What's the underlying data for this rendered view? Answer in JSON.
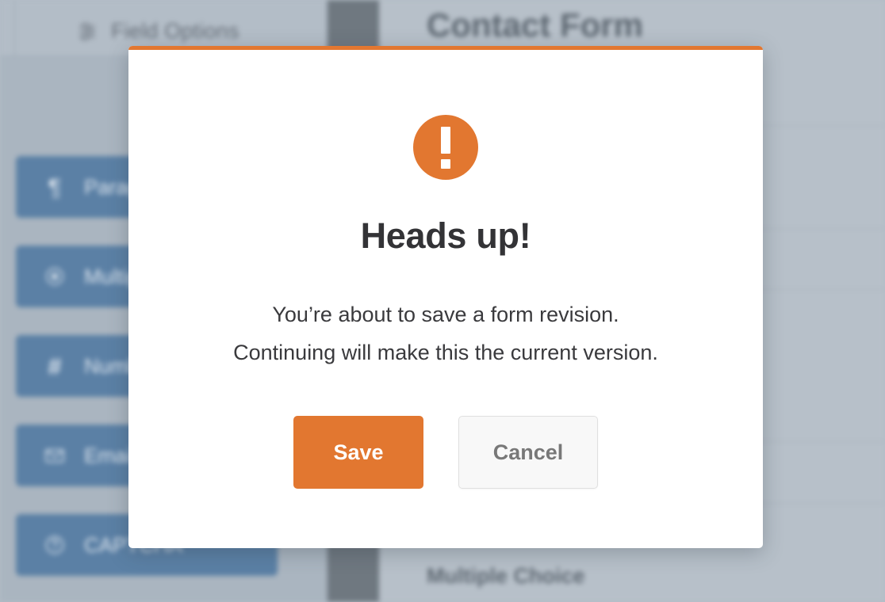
{
  "background": {
    "panel": {
      "header_label": "Field Options",
      "header_icon": "sliders-icon",
      "fields": [
        {
          "label": "Paragraph Text",
          "icon": "pilcrow-icon"
        },
        {
          "label": "Multiple Choice",
          "icon": "radio-circle-icon"
        },
        {
          "label": "Number",
          "icon": "hash-icon"
        },
        {
          "label": "Email",
          "icon": "envelope-icon"
        },
        {
          "label": "CAPTCHA",
          "icon": "question-circle-icon"
        }
      ]
    },
    "preview": {
      "form_title": "Contact Form",
      "bottom_field_label": "Multiple Choice"
    }
  },
  "modal": {
    "accent_color": "#e27730",
    "icon": "exclamation-circle-icon",
    "title": "Heads up!",
    "message_line_1": "You’re about to save a form revision.",
    "message_line_2": "Continuing will make this the current version.",
    "save_label": "Save",
    "cancel_label": "Cancel"
  },
  "colors": {
    "accent_orange": "#e27730",
    "field_blue": "#5b80a5",
    "backdrop": "#b4bec8",
    "dark_strip": "#6f7880",
    "title_text": "#333336",
    "body_text": "#3a3a3d",
    "cancel_text": "#787878"
  }
}
